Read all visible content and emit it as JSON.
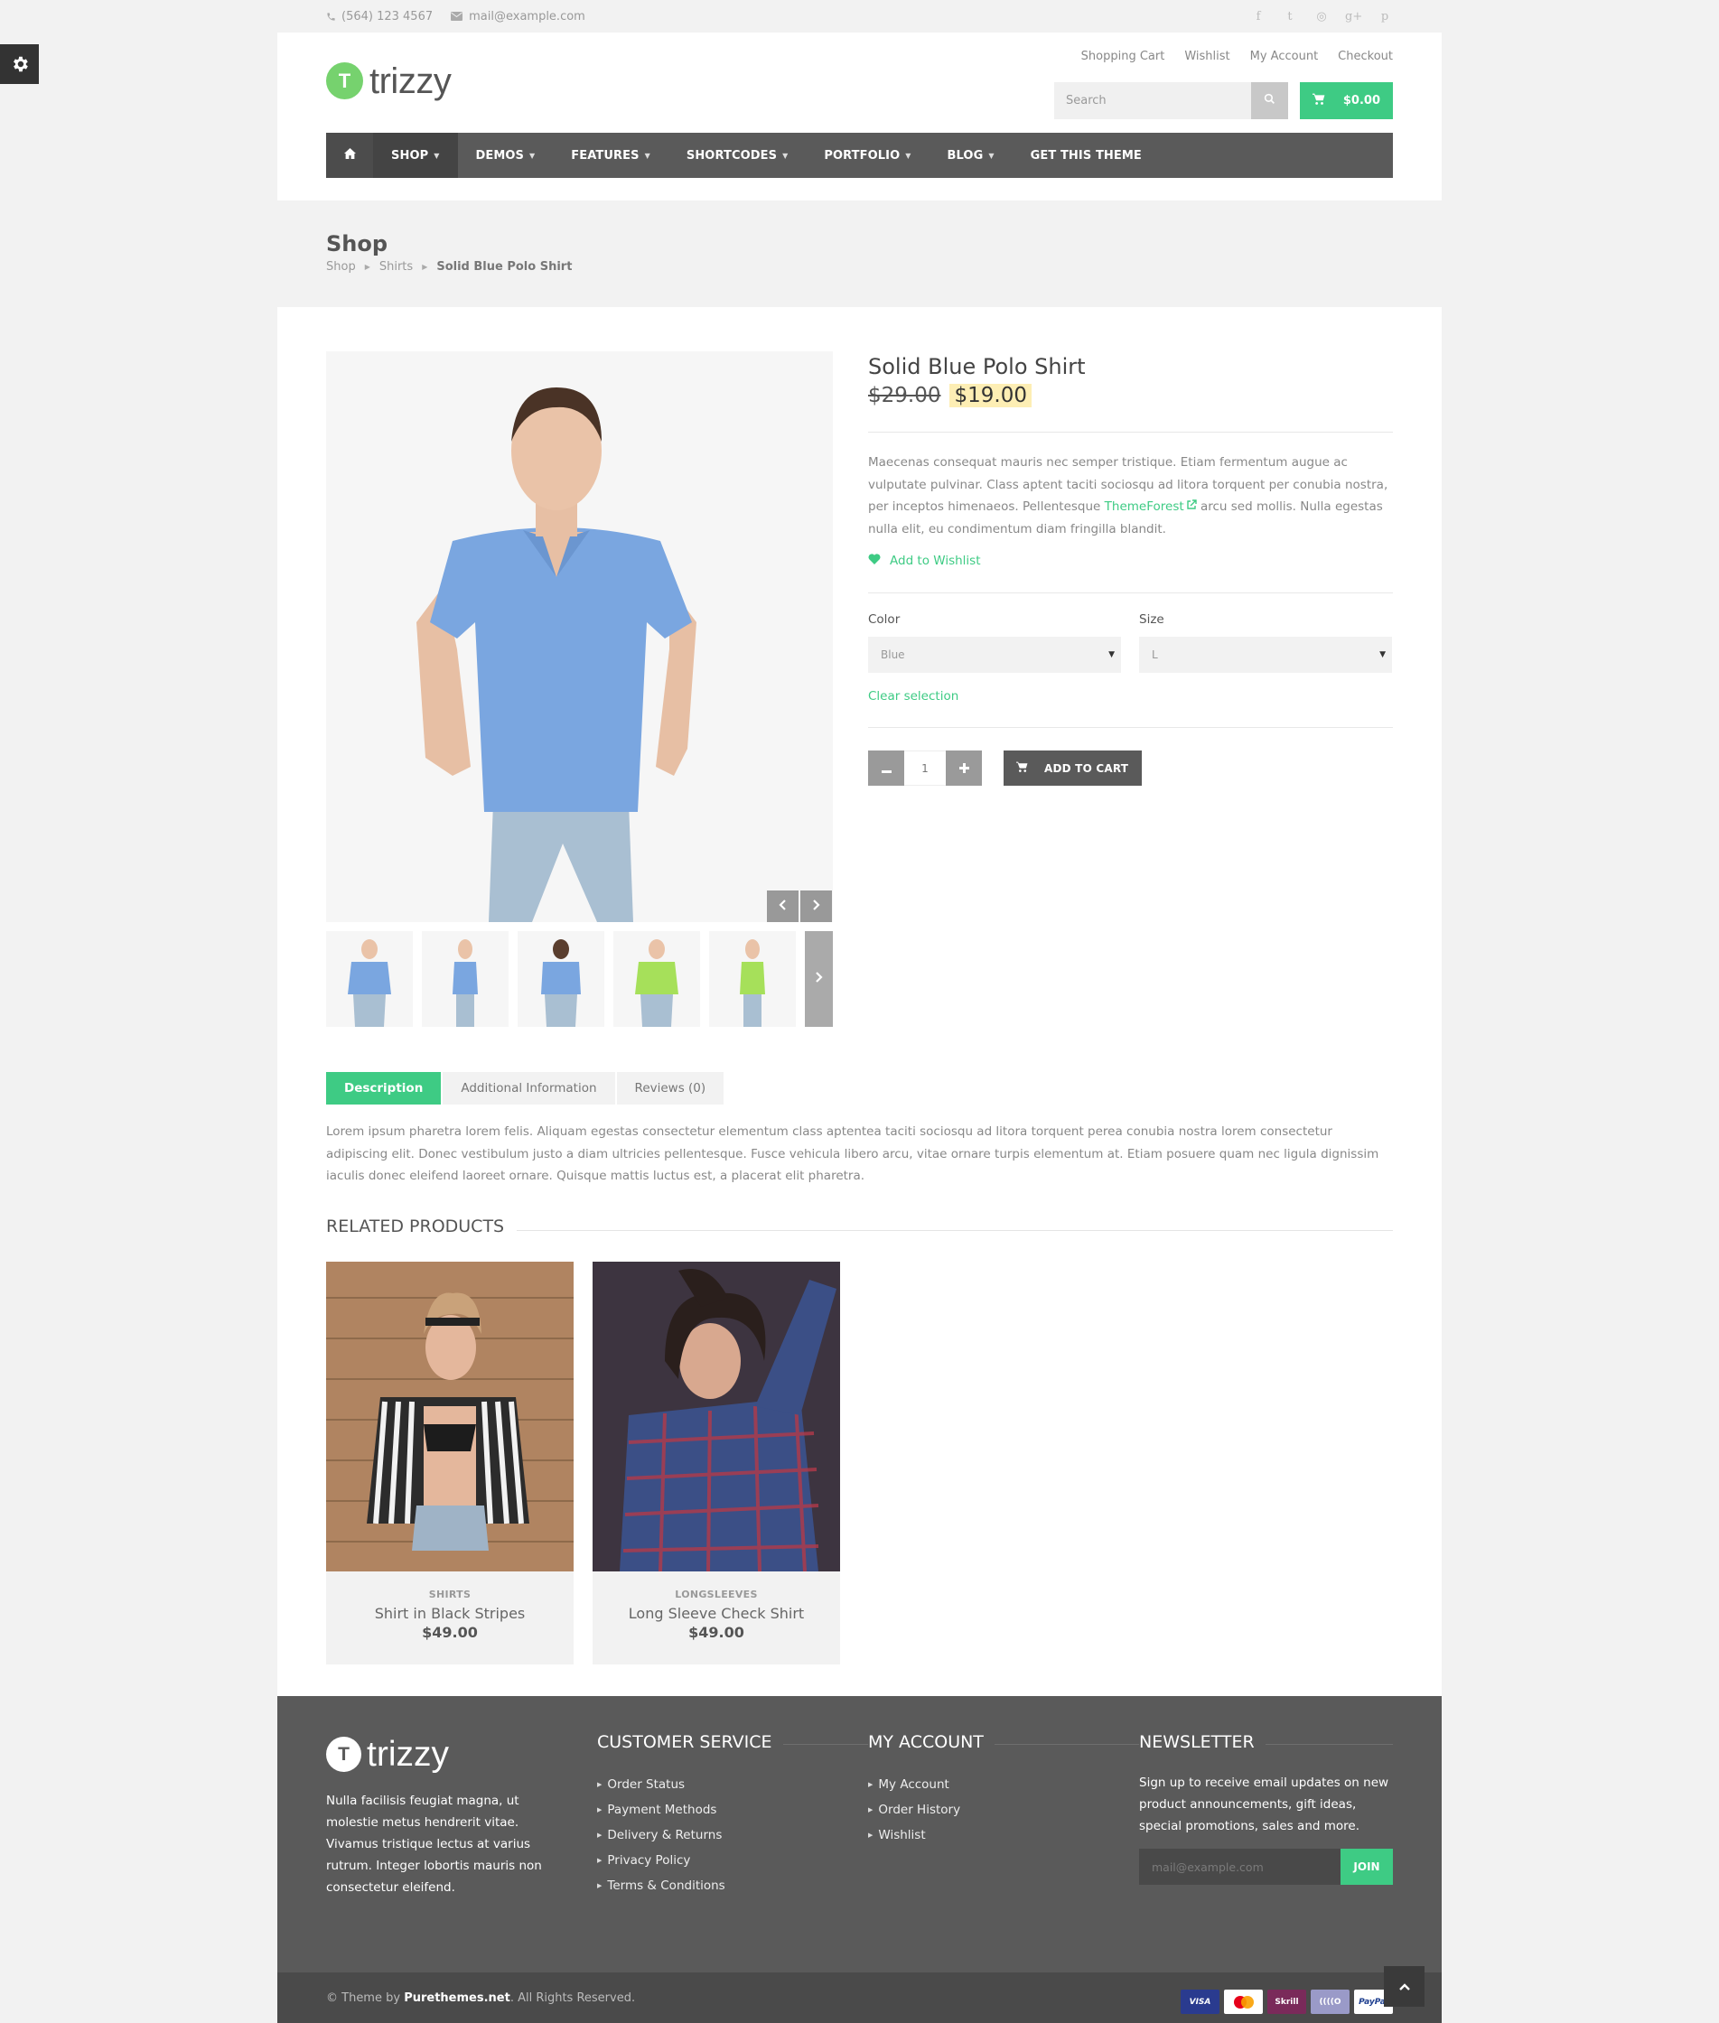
{
  "topbar": {
    "phone": "(564) 123 4567",
    "email": "mail@example.com",
    "social_icons": [
      "facebook-icon",
      "twitter-icon",
      "dribbble-icon",
      "google-plus-icon",
      "pinterest-icon"
    ],
    "social_glyphs": [
      "f",
      "t",
      "◎",
      "g+",
      "p"
    ]
  },
  "header": {
    "logo_letter": "T",
    "logo_text": "trizzy",
    "top_links": [
      "Shopping Cart",
      "Wishlist",
      "My Account",
      "Checkout"
    ],
    "search_placeholder": "Search",
    "cart_total": "$0.00"
  },
  "nav": {
    "items": [
      {
        "label": "SHOP",
        "active": true,
        "dropdown": true
      },
      {
        "label": "DEMOS",
        "dropdown": true
      },
      {
        "label": "FEATURES",
        "dropdown": true
      },
      {
        "label": "SHORTCODES",
        "dropdown": true
      },
      {
        "label": "PORTFOLIO",
        "dropdown": true
      },
      {
        "label": "BLOG",
        "dropdown": true
      },
      {
        "label": "GET THIS THEME",
        "dropdown": false
      }
    ]
  },
  "page": {
    "title": "Shop",
    "breadcrumb": [
      "Shop",
      "Shirts",
      "Solid Blue Polo Shirt"
    ]
  },
  "product": {
    "title": "Solid Blue Polo Shirt",
    "old_price": "$29.00",
    "price": "$19.00",
    "desc_before": "Maecenas consequat mauris nec semper tristique. Etiam fermentum augue ac vulputate pulvinar. Class aptent taciti sociosqu ad litora torquent per conubia nostra, per inceptos himenaeos. Pellentesque ",
    "desc_link": "ThemeForest",
    "desc_after": " arcu sed mollis. Nulla egestas nulla elit, eu condimentum diam fringilla blandit.",
    "wishlist": "Add to Wishlist",
    "color_label": "Color",
    "color_value": "Blue",
    "size_label": "Size",
    "size_value": "L",
    "clear": "Clear selection",
    "quantity": "1",
    "add_to_cart": "ADD TO CART",
    "thumb_colors": [
      "#7aa6e0",
      "#7aa6e0",
      "#7aa6e0",
      "#a6e05a",
      "#a6e05a"
    ]
  },
  "tabs": {
    "items": [
      "Description",
      "Additional Information",
      "Reviews (0)"
    ],
    "active": 0,
    "content": "Lorem ipsum pharetra lorem felis. Aliquam egestas consectetur elementum class aptentea taciti sociosqu ad litora torquent perea conubia nostra lorem consectetur adipiscing elit. Donec vestibulum justo a diam ultricies pellentesque. Fusce vehicula libero arcu, vitae ornare turpis elementum at. Etiam posuere quam nec ligula dignissim iaculis donec eleifend laoreet ornare. Quisque mattis luctus est, a placerat elit pharetra."
  },
  "related": {
    "heading": "RELATED PRODUCTS",
    "products": [
      {
        "category": "SHIRTS",
        "name": "Shirt in Black Stripes",
        "price": "$49.00"
      },
      {
        "category": "LONGSLEEVES",
        "name": "Long Sleeve Check Shirt",
        "price": "$49.00"
      }
    ]
  },
  "footer": {
    "logo_letter": "T",
    "logo_text": "trizzy",
    "about": "Nulla facilisis feugiat magna, ut molestie metus hendrerit vitae. Vivamus tristique lectus at varius rutrum. Integer lobortis mauris non consectetur eleifend.",
    "customer_service": {
      "heading": "CUSTOMER SERVICE",
      "links": [
        "Order Status",
        "Payment Methods",
        "Delivery & Returns",
        "Privacy Policy",
        "Terms & Conditions"
      ]
    },
    "my_account": {
      "heading": "MY ACCOUNT",
      "links": [
        "My Account",
        "Order History",
        "Wishlist"
      ]
    },
    "newsletter": {
      "heading": "NEWSLETTER",
      "text": "Sign up to receive email updates on new product announcements, gift ideas, special promotions, sales and more.",
      "placeholder": "mail@example.com",
      "button": "JOIN"
    },
    "copyright_prefix": "© Theme by ",
    "copyright_brand": "Purethemes.net",
    "copyright_suffix": ". All Rights Reserved.",
    "payment_cards": [
      {
        "label": "VISA",
        "bg": "#2a3b8f",
        "fg": "#ffffff"
      },
      {
        "label": "",
        "bg": "#ffffff",
        "fg": "#e6001a"
      },
      {
        "label": "Skrill",
        "bg": "#7a2a5a",
        "fg": "#ffffff"
      },
      {
        "label": "((((O",
        "bg": "#9a9ac8",
        "fg": "#ffffff"
      },
      {
        "label": "PayPal",
        "bg": "#ffffff",
        "fg": "#1e3f8f"
      }
    ]
  },
  "colors": {
    "accent": "#3ecb84",
    "nav_bg": "#5a5a5a",
    "footer_bg": "#5a5a5a",
    "price_highlight": "#fdeeb4"
  }
}
